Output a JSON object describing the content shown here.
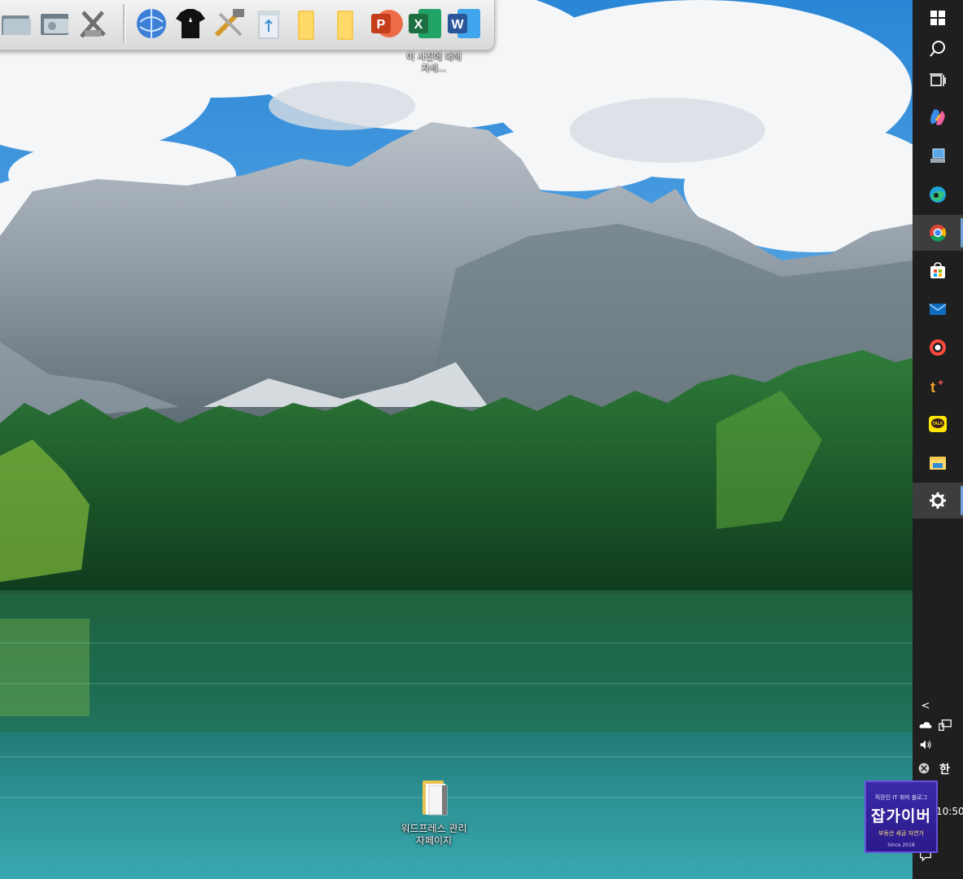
{
  "dock": {
    "items": [
      {
        "name": "folder-app-icon"
      },
      {
        "name": "drive-app-icon"
      },
      {
        "name": "tools-app-icon"
      },
      {
        "name": "globe-app-icon"
      },
      {
        "name": "tshirt-app-icon"
      },
      {
        "name": "hammer-wrench-app-icon"
      },
      {
        "name": "recycle-bin-icon"
      },
      {
        "name": "folder-icon"
      },
      {
        "name": "folder-icon"
      },
      {
        "name": "powerpoint-icon",
        "letter": "P",
        "color": "#c43e1c"
      },
      {
        "name": "excel-icon",
        "letter": "X",
        "color": "#1d6f42"
      },
      {
        "name": "word-icon",
        "letter": "W",
        "color": "#2b579a"
      }
    ],
    "tooltip": "이 사진에 대해 자세..."
  },
  "desktop": {
    "icon_label": "워드프레스 관리자페이지"
  },
  "taskbar": {
    "buttons": [
      {
        "name": "start-icon"
      },
      {
        "name": "search-icon"
      },
      {
        "name": "task-view-icon"
      },
      {
        "name": "copilot-icon"
      },
      {
        "name": "computer-icon"
      },
      {
        "name": "edge-icon"
      },
      {
        "name": "chrome-icon"
      },
      {
        "name": "store-icon"
      },
      {
        "name": "mail-icon"
      },
      {
        "name": "ring-app-icon"
      },
      {
        "name": "tplus-icon",
        "label": "t+"
      },
      {
        "name": "kakaotalk-icon",
        "label": "TALK"
      },
      {
        "name": "file-explorer-icon"
      },
      {
        "name": "settings-icon"
      }
    ],
    "tray": {
      "chevron": "<",
      "ime_label": "한",
      "clock_time": "10:50"
    }
  },
  "watermark": {
    "top": "직장인 IT 취미 블로그",
    "main": "잡가이버",
    "sub": "부동산 세금 자연가",
    "since": "Since 2018"
  },
  "colors": {
    "taskbar_bg": "#1f1f1f",
    "active_indicator": "#6fa0d8",
    "watermark_bg": "#3b2aa8"
  }
}
